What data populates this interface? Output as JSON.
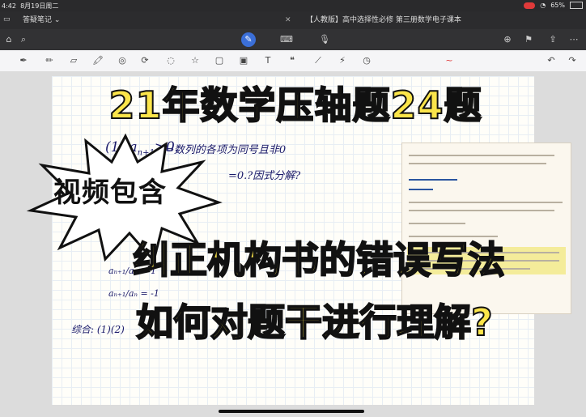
{
  "status": {
    "time": "4:42",
    "date": "8月19日周二",
    "battery": "65%"
  },
  "tabs": {
    "left_title": "答疑笔记",
    "right_title": "【人教版】高中选择性必修 第三册数学电子课本"
  },
  "handwriting": {
    "line1": "(1) a",
    "line1b": "n+1",
    "line1c": ">0.",
    "line1d": "⇔数列的各项为同号且非0",
    "line2": "=0.?因式分解?",
    "frac1": "aₙ₊₁/aₙ = 1",
    "frac2": "aₙ₊₁/aₙ = -1",
    "summary": "综合: (1)(2)"
  },
  "overlay": {
    "title": "21年数学压轴题24题",
    "badge": "视频包含",
    "subtitle1": "纠正机构书的错误写法",
    "subtitle2": "如何对题干进行理解?"
  },
  "toolbar2_icons": [
    "pen-icon",
    "pencil-icon",
    "eraser-icon",
    "highlighter-icon",
    "shape-icon",
    "lasso-icon",
    "lasso-dotted-icon",
    "star-icon",
    "sticky-icon",
    "image-icon",
    "text-icon",
    "quote-icon",
    "ruler-icon",
    "laser-icon",
    "clock-icon"
  ]
}
